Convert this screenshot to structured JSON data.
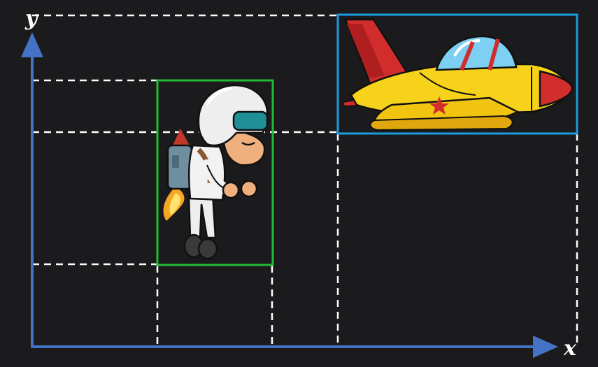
{
  "axes": {
    "x_label": "x",
    "y_label": "y",
    "axis_color": "#4472c4"
  },
  "objects": [
    {
      "name": "jetpack-character",
      "box_color": "#22bb33"
    },
    {
      "name": "fighter-jet",
      "box_color": "#1b9be0"
    }
  ],
  "guide_color": "#ffffff"
}
